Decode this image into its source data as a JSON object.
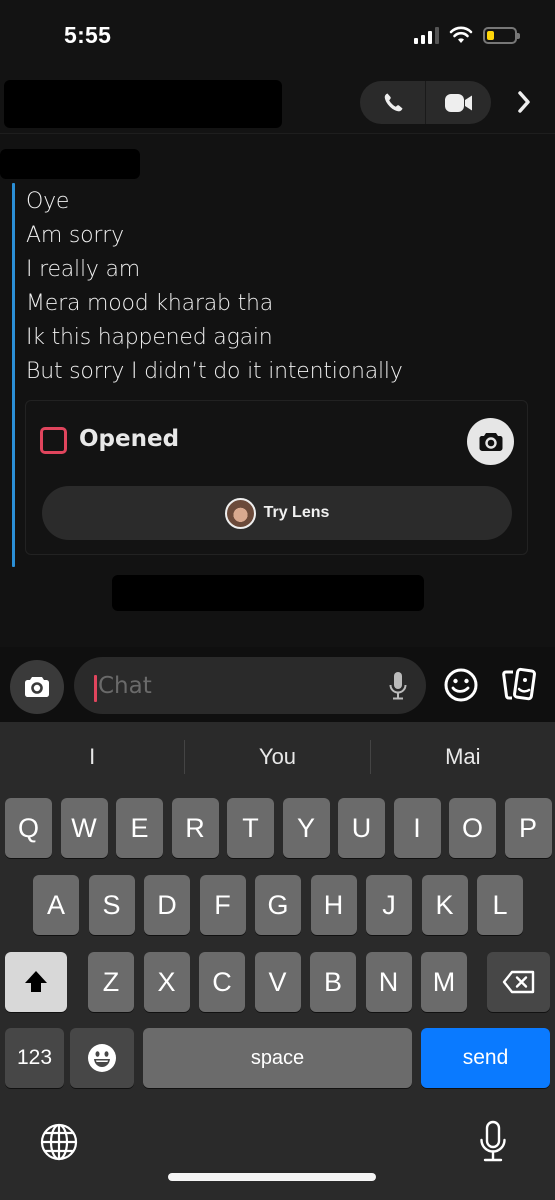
{
  "status_bar": {
    "time": "5:55",
    "signal_bars": 3,
    "signal_bars_total": 4,
    "wifi": "wifi-icon",
    "battery_level_fraction": 0.2,
    "battery_color": "#ffd60a"
  },
  "header": {
    "contact_name": "[redacted]",
    "call_icon": "phone-icon",
    "video_icon": "video-camera-icon",
    "more_icon": "chevron-right-icon"
  },
  "conversation": {
    "sender_name": "[redacted]",
    "accent_color": "#2b8fd6",
    "messages": [
      "Oye",
      "Am sorry",
      "I really am",
      "Mera mood kharab tha",
      "Ik this happened again",
      "But sorry I didn’t do it intentionally"
    ],
    "snap": {
      "status": "Opened",
      "status_color": "#e0455d",
      "camera_icon": "camera-icon",
      "lens_button_label": "Try Lens"
    },
    "footer_text": "[redacted]"
  },
  "input_bar": {
    "camera_icon": "camera-icon",
    "placeholder": "Chat",
    "value": "",
    "mic_icon": "microphone-icon",
    "emoji_icon": "smiley-icon",
    "cards_icon": "cards-icon"
  },
  "keyboard": {
    "suggestions": [
      "I",
      "You",
      "Mai"
    ],
    "rows": [
      [
        "Q",
        "W",
        "E",
        "R",
        "T",
        "Y",
        "U",
        "I",
        "O",
        "P"
      ],
      [
        "A",
        "S",
        "D",
        "F",
        "G",
        "H",
        "J",
        "K",
        "L"
      ],
      [
        "Z",
        "X",
        "C",
        "V",
        "B",
        "N",
        "M"
      ]
    ],
    "shift_icon": "shift-arrow-icon",
    "backspace_icon": "backspace-icon",
    "numbers_label": "123",
    "emoji_key_icon": "emoji-icon",
    "space_label": "space",
    "send_label": "send",
    "send_color": "#0a7aff",
    "globe_icon": "globe-icon",
    "dictation_icon": "microphone-icon"
  }
}
